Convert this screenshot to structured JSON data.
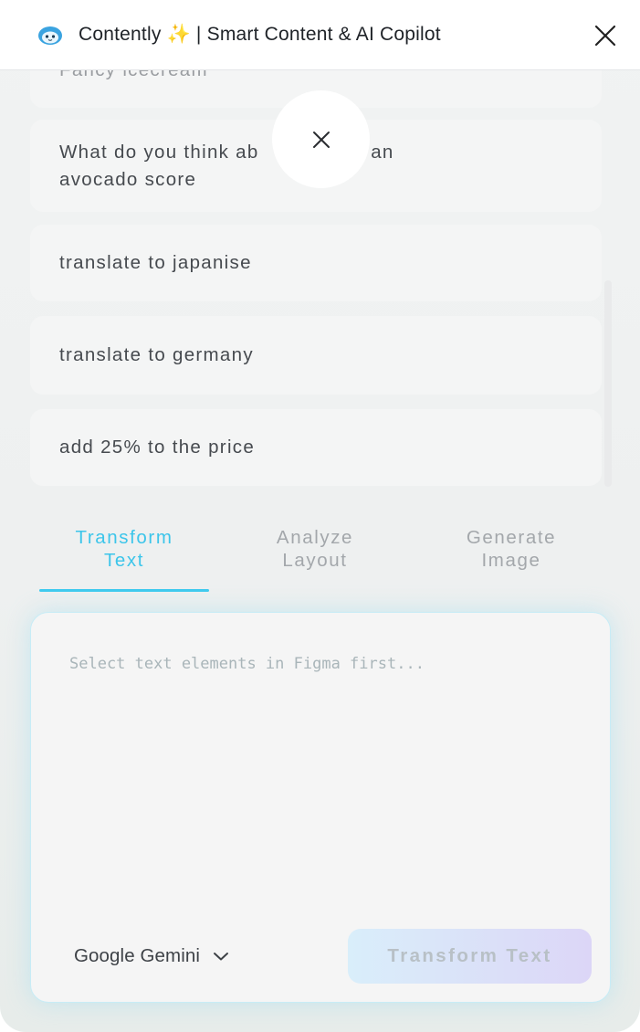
{
  "window": {
    "title": "Contently ✨ | Smart Content & AI Copilot"
  },
  "history": {
    "items": [
      {
        "text": "Fancy icecream"
      },
      {
        "text": "What do you think ab            e me an avocado score"
      },
      {
        "text": "translate to japanise"
      },
      {
        "text": "translate to germany"
      },
      {
        "text": "add 25% to the price"
      }
    ]
  },
  "tabs": [
    {
      "line1": "Transform",
      "line2": "Text",
      "active": true
    },
    {
      "line1": "Analyze",
      "line2": "Layout",
      "active": false
    },
    {
      "line1": "Generate",
      "line2": "Image",
      "active": false
    }
  ],
  "editor": {
    "placeholder": "Select text elements in Figma first...",
    "value": ""
  },
  "model_select": {
    "selected": "Google Gemini"
  },
  "actions": {
    "transform_label": "Transform Text"
  },
  "colors": {
    "accent": "#3cc5ea",
    "inactive_tab": "#a3a7ab",
    "button_gradient_start": "#d9eefa",
    "button_gradient_end": "#dcd6f7"
  },
  "icons": {
    "logo": "cloud-mascot-icon",
    "close": "close-icon",
    "dropdown": "chevron-down-icon"
  }
}
